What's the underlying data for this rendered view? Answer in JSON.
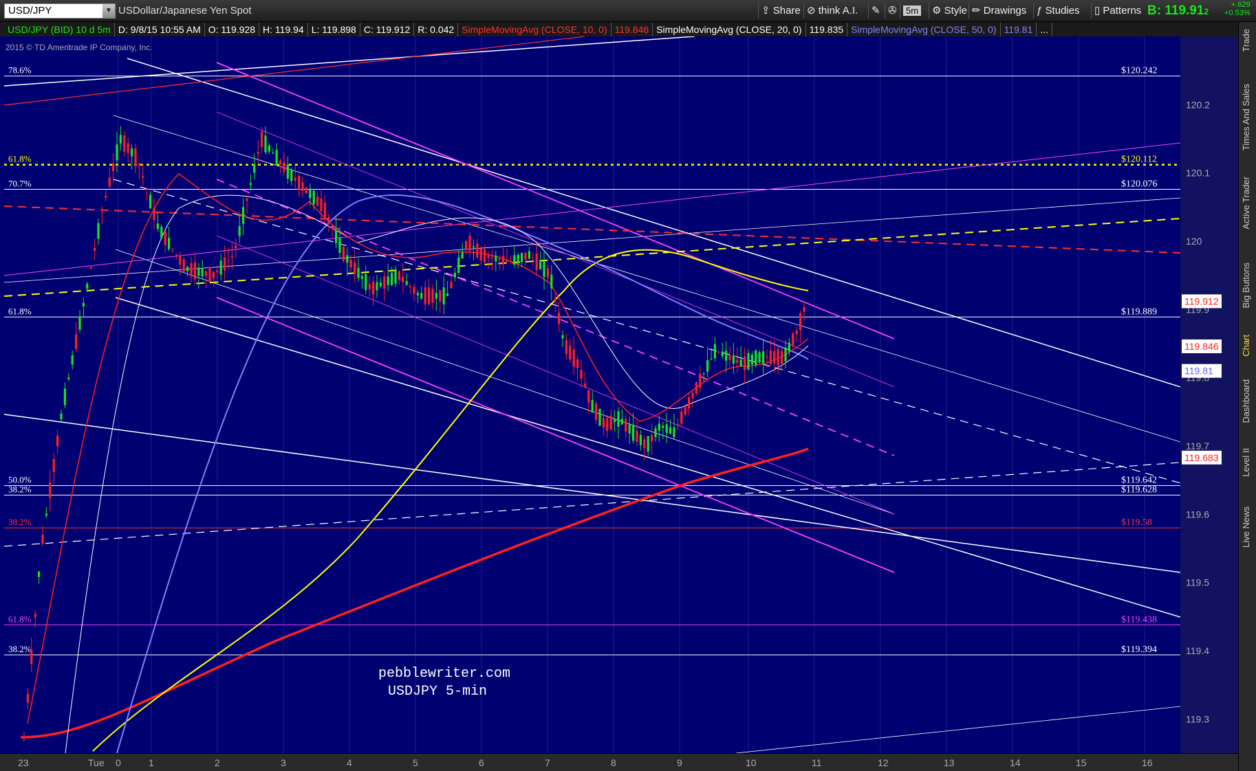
{
  "toolbar": {
    "symbol": "USD/JPY",
    "description": "USDollar/Japanese Yen Spot",
    "buttons": [
      "Share",
      "think A.I.",
      "5m",
      "Style",
      "Drawings",
      "Studies",
      "Patterns"
    ],
    "bid": "B: 119.91",
    "bid_sub": "2",
    "change_pts": "+.629",
    "change_pct": "+0.53%"
  },
  "status": {
    "symbol": "USD/JPY (BID) 10 d 5m",
    "date": "D: 9/8/15 10:55 AM",
    "open": "O: 119.928",
    "high": "H: 119.94",
    "low": "L: 119.898",
    "close": "C: 119.912",
    "range": "R: 0.042",
    "sma10": "SimpleMovingAvg (CLOSE, 10, 0)",
    "sma10_val": "119.846",
    "sma20": "SimpleMovingAvg (CLOSE, 20, 0)",
    "sma20_val": "119.835",
    "sma50": "SimpleMovingAvg (CLOSE, 50, 0)",
    "sma50_val": "119.81",
    "more": "..."
  },
  "copyright": "2015 © TD Ameritrade IP Company, Inc.",
  "watermark": [
    "pebblewriter.com",
    "USDJPY 5-min"
  ],
  "right_tabs": [
    "Trade",
    "Times And Sales",
    "Active Trader",
    "Big Buttons",
    "Chart",
    "Dashboard",
    "Level II",
    "Live News"
  ],
  "colors": {
    "background": "#000070",
    "sma10": "#ff3030",
    "sma20": "#ffffff",
    "sma50": "#8080ff",
    "sma_long": "#ffff00",
    "magenta": "#ff40ff",
    "bid_green": "#19e619"
  },
  "chart_data": {
    "type": "line",
    "title": "",
    "xlabel": "",
    "ylabel": "",
    "ylim": [
      119.25,
      120.3
    ],
    "y_ticks": [
      "120.2",
      "120.1",
      "120",
      "119.9",
      "119.8",
      "119.7",
      "119.6",
      "119.5",
      "119.4",
      "119.3"
    ],
    "x_ticks": [
      "23",
      "Tue",
      "0",
      "1",
      "2",
      "3",
      "4",
      "5",
      "6",
      "7",
      "8",
      "9",
      "10",
      "11",
      "12",
      "13",
      "14",
      "15",
      "16"
    ],
    "price_labels": [
      {
        "text": "119.912",
        "value": 119.912,
        "color": "#ff2020"
      },
      {
        "text": "119.846",
        "value": 119.846,
        "color": "#ff2020"
      },
      {
        "text": "119.81",
        "value": 119.81,
        "color": "#6060ff"
      },
      {
        "text": "119.683",
        "value": 119.683,
        "color": "#ff2020"
      }
    ],
    "fib_levels": [
      {
        "pct": "78.6%",
        "label": "$120.242",
        "value": 120.242,
        "color": "#ffffff",
        "style": "solid"
      },
      {
        "pct": "61.8%",
        "label": "$120.112",
        "value": 120.112,
        "color": "#ffff00",
        "style": "dotted"
      },
      {
        "pct": "70.7%",
        "label": "$120.076",
        "value": 120.076,
        "color": "#ffffff",
        "style": "solid"
      },
      {
        "pct": "61.8%",
        "label": "$119.889",
        "value": 119.889,
        "color": "#ffffff",
        "style": "solid"
      },
      {
        "pct": "50.0%",
        "label": "$119.642",
        "value": 119.642,
        "color": "#ffffff",
        "style": "solid"
      },
      {
        "pct": "38.2%",
        "label": "$119.628",
        "value": 119.628,
        "color": "#ffffff",
        "style": "solid"
      },
      {
        "pct": "38.2%",
        "label": "$119.58",
        "value": 119.58,
        "color": "#ff3030",
        "style": "solid"
      },
      {
        "pct": "61.8%",
        "label": "$119.438",
        "value": 119.438,
        "color": "#ff40ff",
        "style": "solid"
      },
      {
        "pct": "38.2%",
        "label": "$119.394",
        "value": 119.394,
        "color": "#ffffff",
        "style": "solid"
      }
    ],
    "series": [
      {
        "name": "SimpleMovingAvg (CLOSE, 10, 0)",
        "color": "#ff3030"
      },
      {
        "name": "SimpleMovingAvg (CLOSE, 20, 0)",
        "color": "#ffffff"
      },
      {
        "name": "SimpleMovingAvg (CLOSE, 50, 0)",
        "color": "#8080ff"
      }
    ],
    "grid": true
  }
}
